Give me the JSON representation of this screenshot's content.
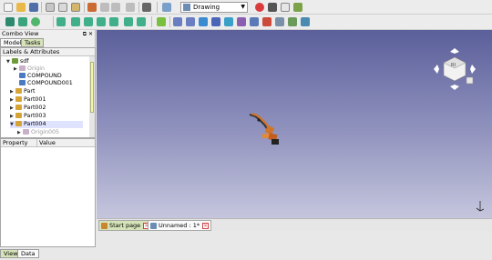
{
  "toolbar": {
    "workbench": "Drawing"
  },
  "combo": {
    "title": "Combo View",
    "tabs": [
      "Model",
      "Tasks"
    ],
    "tree_header": "Labels & Attributes",
    "nodes": [
      {
        "label": "sdf"
      },
      {
        "label": "Origin"
      },
      {
        "label": "COMPOUND"
      },
      {
        "label": "COMPOUND001"
      },
      {
        "label": "Part"
      },
      {
        "label": "Part001"
      },
      {
        "label": "Part002"
      },
      {
        "label": "Part003"
      },
      {
        "label": "Part004"
      },
      {
        "label": "Origin005"
      }
    ],
    "props": {
      "col1": "Property",
      "col2": "Value"
    },
    "bottom_tabs": [
      "View",
      "Data"
    ]
  },
  "navcube": {
    "face_label": "RI"
  },
  "doc_tabs": [
    {
      "label": "Start page"
    },
    {
      "label": "Unnamed : 1*"
    }
  ],
  "colors": {
    "view_top": "#5b5f9a",
    "view_bottom": "#c5c6dd",
    "model": "#d0742a",
    "selected": "#dfe3ff"
  }
}
